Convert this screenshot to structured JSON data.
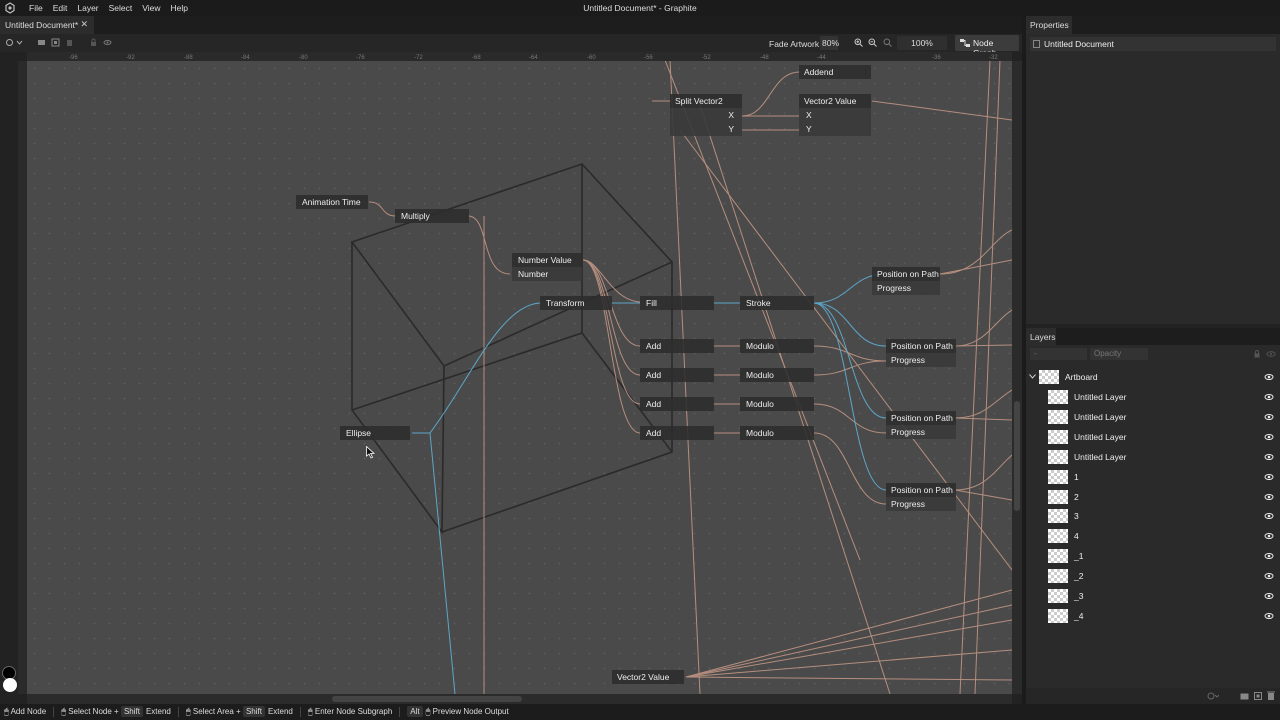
{
  "window": {
    "title": "Untitled Document* - Graphite"
  },
  "menu": [
    "File",
    "Edit",
    "Layer",
    "Select",
    "View",
    "Help"
  ],
  "document_tab": {
    "label": "Untitled Document*"
  },
  "toolbar": {
    "fade_artwork_label": "Fade Artwork",
    "fade_artwork_value": "80%",
    "zoom": "100%",
    "node_graph_label": "Node Graph"
  },
  "ruler": {
    "top_ticks": [
      "-96",
      "-92",
      "-88",
      "-84",
      "-80",
      "-76",
      "-72",
      "-68",
      "-64",
      "-60",
      "-56",
      "-52",
      "-48",
      "-44",
      "-36",
      "-32"
    ]
  },
  "nodes": {
    "animation_time": "Animation Time",
    "multiply": "Multiply",
    "number_value": "Number Value",
    "number": "Number",
    "transform": "Transform",
    "fill": "Fill",
    "stroke": "Stroke",
    "ellipse": "Ellipse",
    "add": "Add",
    "modulo": "Modulo",
    "position_on_path": "Position on Path",
    "progress": "Progress",
    "split_vector2": "Split Vector2",
    "x": "X",
    "y": "Y",
    "vector2_value": "Vector2 Value",
    "addend": "Addend"
  },
  "status": {
    "add_node": "Add Node",
    "select_node": "Select Node",
    "shift": "Shift",
    "extend": "Extend",
    "select_area": "Select Area",
    "enter_node_subgraph": "Enter Node Subgraph",
    "alt": "Alt",
    "preview_node_output": "Preview Node Output"
  },
  "properties": {
    "tab": "Properties",
    "document_name": "Untitled Document"
  },
  "layers": {
    "tab": "Layers",
    "blend_placeholder": "-",
    "opacity_placeholder": "Opacity",
    "artboard": "Artboard",
    "items": [
      "Untitled Layer",
      "Untitled Layer",
      "Untitled Layer",
      "Untitled Layer",
      "1",
      "2",
      "3",
      "4",
      "_1",
      "_2",
      "_3",
      "_4"
    ]
  },
  "colors": {
    "wire_orange": "#c89a88",
    "wire_blue": "#5fb0d6",
    "canvas_bg": "#4a4a4a",
    "panel_bg": "#2a2a2a"
  }
}
